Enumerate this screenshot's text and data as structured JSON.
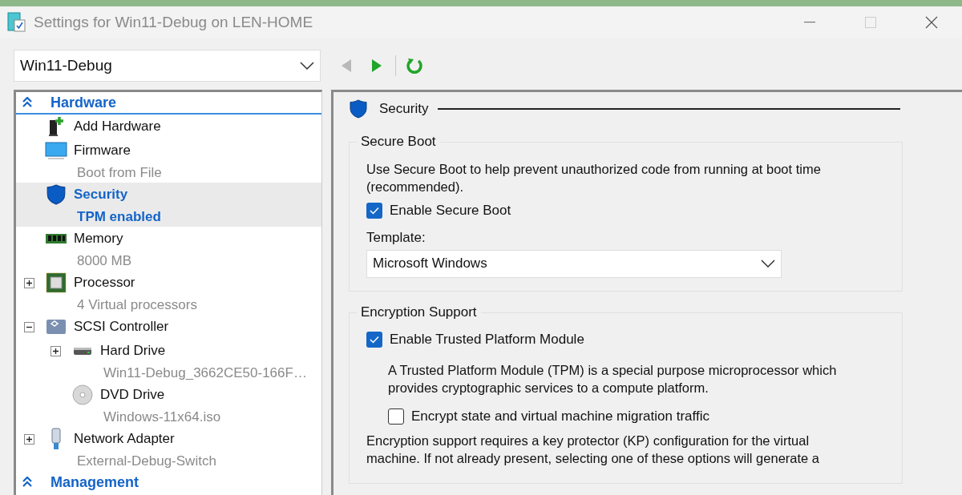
{
  "window": {
    "title": "Settings for Win11-Debug on LEN-HOME"
  },
  "toolbar": {
    "vm_select": {
      "value": "Win11-Debug"
    },
    "buttons": [
      {
        "kind": "back",
        "disabled": true
      },
      {
        "kind": "play",
        "disabled": false
      },
      {
        "kind": "refresh",
        "disabled": false
      }
    ]
  },
  "sidebar": {
    "sections": [
      {
        "label": "Hardware",
        "expanded": true,
        "items": [
          {
            "kind": "addhw",
            "name": "Add Hardware",
            "selected": false
          },
          {
            "kind": "firmware",
            "name": "Firmware",
            "detail": "Boot from File",
            "selected": false
          },
          {
            "kind": "security",
            "name": "Security",
            "detail": "TPM enabled",
            "selected": true
          },
          {
            "kind": "memory",
            "name": "Memory",
            "detail": "8000 MB",
            "selected": false
          },
          {
            "kind": "processor",
            "name": "Processor",
            "detail": "4 Virtual processors",
            "selected": false,
            "expanded": false
          },
          {
            "kind": "scsi",
            "name": "SCSI Controller",
            "selected": false,
            "expanded": true,
            "children": [
              {
                "kind": "disk",
                "name": "Hard Drive",
                "detail": "Win11-Debug_3662CE50-166F…",
                "selected": false,
                "expanded": false
              },
              {
                "kind": "dvd",
                "name": "DVD Drive",
                "detail": "Windows-11x64.iso",
                "selected": false
              }
            ]
          },
          {
            "kind": "network",
            "name": "Network Adapter",
            "detail": "External-Debug-Switch",
            "selected": false,
            "expanded": false
          }
        ]
      },
      {
        "label": "Management",
        "expanded": true
      }
    ]
  },
  "content": {
    "title": "Security",
    "groups": [
      {
        "legend": "Secure Boot",
        "controls": [
          {
            "kind": "text",
            "text": "Use Secure Boot to help prevent unauthorized code from running at boot time (recommended)."
          },
          {
            "kind": "checkbox",
            "label": "Enable Secure Boot",
            "checked": true
          },
          {
            "kind": "label",
            "text": "Template:"
          },
          {
            "kind": "select",
            "value": "Microsoft Windows"
          }
        ]
      },
      {
        "legend": "Encryption Support",
        "controls": [
          {
            "kind": "checkbox",
            "label": "Enable Trusted Platform Module",
            "checked": true,
            "children": [
              {
                "kind": "text",
                "text": "A Trusted Platform Module (TPM) is a special purpose microprocessor which provides cryptographic services to a compute platform."
              },
              {
                "kind": "checkbox",
                "label": "Encrypt state and virtual machine migration traffic",
                "checked": false
              }
            ]
          },
          {
            "kind": "text",
            "text": "Encryption support requires a key protector (KP) configuration for the virtual machine. If not already present, selecting one of these options will generate a"
          }
        ]
      }
    ]
  }
}
